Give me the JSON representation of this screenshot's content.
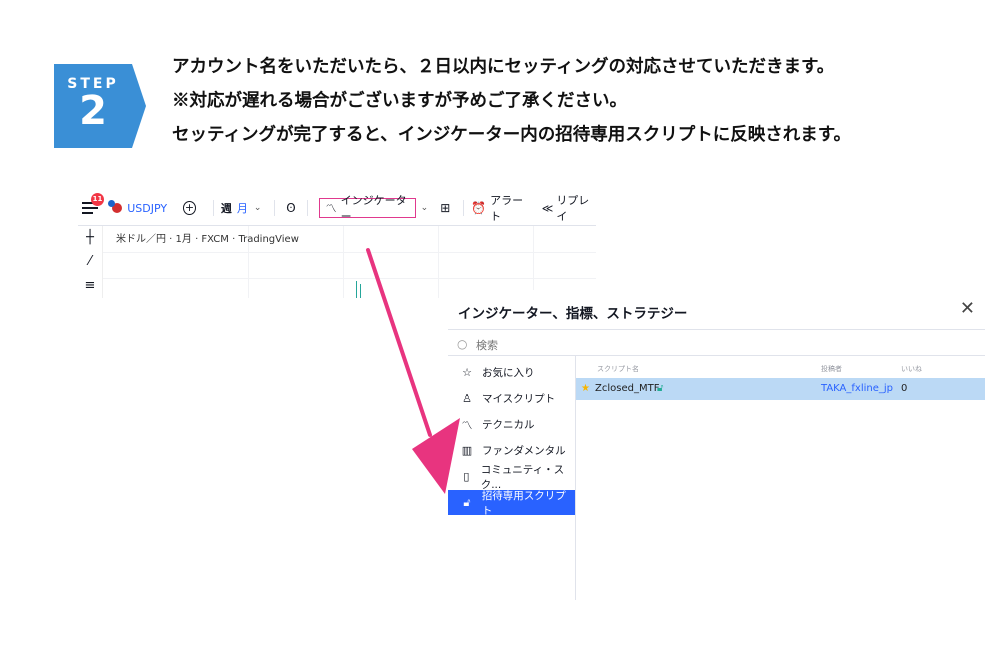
{
  "step": {
    "label": "STEP",
    "number": "2"
  },
  "instructions": [
    "アカウント名をいただいたら、２日以内にセッティングの対応させていただきます。",
    "※対応が遅れる場合がございますが予めご了承ください。",
    "セッティングが完了すると、インジケーター内の招待専用スクリプトに反映されます。"
  ],
  "toolbar": {
    "badge_count": "11",
    "symbol": "USDJPY",
    "timeframe_week": "週",
    "timeframe_month": "月",
    "indicators_label": "インジケーター",
    "alerts_label": "アラート",
    "replay_label": "リプレイ"
  },
  "chart": {
    "title": "米ドル／円 · 1月 · FXCM · TradingView"
  },
  "dialog": {
    "title": "インジケーター、指標、ストラテジー",
    "search_placeholder": "検索",
    "sidebar": [
      {
        "label": "お気に入り",
        "icon": "star-outline-icon"
      },
      {
        "label": "マイスクリプト",
        "icon": "user-icon"
      },
      {
        "label": "テクニカル",
        "icon": "chart-icon"
      },
      {
        "label": "ファンダメンタル",
        "icon": "bar-chart-icon"
      },
      {
        "label": "コミュニティ・スク...",
        "icon": "bookmark-icon"
      },
      {
        "label": "招待専用スクリプト",
        "icon": "lock-icon",
        "active": true
      }
    ],
    "columns": {
      "script": "スクリプト名",
      "author": "投稿者",
      "likes": "いいね"
    },
    "rows": [
      {
        "name": "Zclosed_MTF",
        "author": "TAKA_fxline_jp",
        "likes": "0"
      }
    ]
  },
  "colors": {
    "accent": "#2962ff",
    "step_blue": "#3a8fd6",
    "arrow_pink": "#e8347f",
    "row_highlight": "#bbd9f5"
  }
}
